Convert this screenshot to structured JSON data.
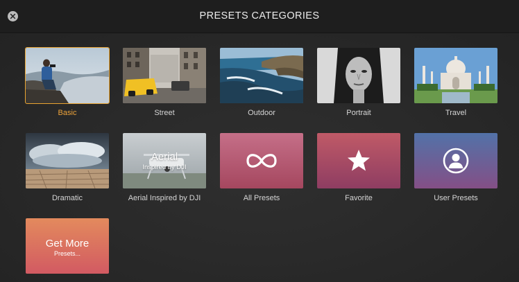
{
  "window": {
    "title": "PRESETS CATEGORIES",
    "close_icon": "close-icon"
  },
  "colors": {
    "selected_accent": "#e9a431",
    "caption_text": "#d6d6d6",
    "background": "#262626"
  },
  "tiles": [
    {
      "label": "Basic",
      "selected": true,
      "kind": "photo"
    },
    {
      "label": "Street",
      "selected": false,
      "kind": "photo"
    },
    {
      "label": "Outdoor",
      "selected": false,
      "kind": "photo"
    },
    {
      "label": "Portrait",
      "selected": false,
      "kind": "photo"
    },
    {
      "label": "Travel",
      "selected": false,
      "kind": "photo"
    },
    {
      "label": "Dramatic",
      "selected": false,
      "kind": "photo"
    },
    {
      "label": "Aerial Inspired by DJI",
      "selected": false,
      "kind": "photo",
      "overlay_title": "Aerial",
      "overlay_sub": "Inspired by DJI"
    },
    {
      "label": "All Presets",
      "selected": false,
      "kind": "icon",
      "icon": "infinity-icon"
    },
    {
      "label": "Favorite",
      "selected": false,
      "kind": "icon",
      "icon": "star-icon"
    },
    {
      "label": "User Presets",
      "selected": false,
      "kind": "icon",
      "icon": "user-icon"
    },
    {
      "label": "",
      "selected": false,
      "kind": "promo",
      "overlay_title": "Get More",
      "overlay_sub": "Presets..."
    }
  ]
}
